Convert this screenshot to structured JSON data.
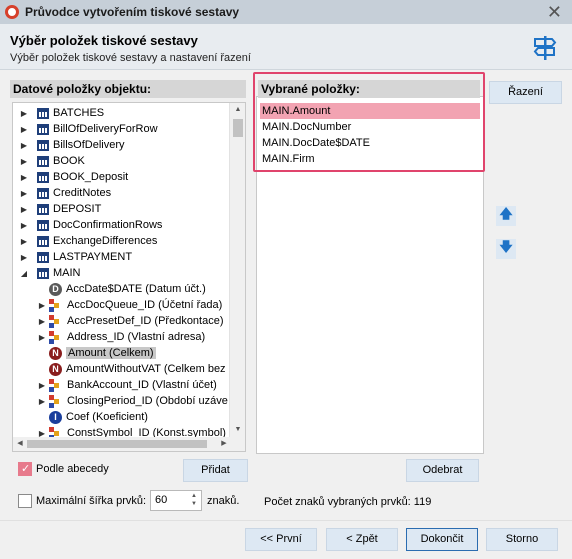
{
  "window": {
    "title": "Průvodce vytvořením tiskové sestavy",
    "close_symbol": "✕"
  },
  "header": {
    "title": "Výběr položek tiskové sestavy",
    "subtitle": "Výběr položek tiskové sestavy a nastavení řazení",
    "icon": "signpost-icon"
  },
  "left_panel": {
    "label": "Datové položky objektu:",
    "tree": [
      {
        "label": "BATCHES",
        "type": "table",
        "expand": "▶"
      },
      {
        "label": "BillOfDeliveryForRow",
        "type": "table",
        "expand": "▶"
      },
      {
        "label": "BillsOfDelivery",
        "type": "table",
        "expand": "▶"
      },
      {
        "label": "BOOK",
        "type": "table",
        "expand": "▶"
      },
      {
        "label": "BOOK_Deposit",
        "type": "table",
        "expand": "▶"
      },
      {
        "label": "CreditNotes",
        "type": "table",
        "expand": "▶"
      },
      {
        "label": "DEPOSIT",
        "type": "table",
        "expand": "▶"
      },
      {
        "label": "DocConfirmationRows",
        "type": "table",
        "expand": "▶"
      },
      {
        "label": "ExchangeDifferences",
        "type": "table",
        "expand": "▶"
      },
      {
        "label": "LASTPAYMENT",
        "type": "table",
        "expand": "▶"
      },
      {
        "label": "MAIN",
        "type": "table",
        "expand": "◢"
      },
      {
        "label": "AccDate$DATE (Datum účt.)",
        "type": "date",
        "glyph": "D"
      },
      {
        "label": "AccDocQueue_ID (Účetní řada)",
        "type": "relation",
        "expand": "▶"
      },
      {
        "label": "AccPresetDef_ID (Předkontace)",
        "type": "relation",
        "expand": "▶"
      },
      {
        "label": "Address_ID (Vlastní adresa)",
        "type": "relation",
        "expand": "▶"
      },
      {
        "label": "Amount (Celkem)",
        "type": "number",
        "glyph": "N",
        "selected": true
      },
      {
        "label": "AmountWithoutVAT (Celkem bez",
        "type": "number",
        "glyph": "N"
      },
      {
        "label": "BankAccount_ID (Vlastní účet)",
        "type": "relation",
        "expand": "▶"
      },
      {
        "label": "ClosingPeriod_ID (Období uzáve",
        "type": "relation",
        "expand": "▶"
      },
      {
        "label": "Coef (Koeficient)",
        "type": "integer",
        "glyph": "I"
      },
      {
        "label": "ConstSymbol_ID (Konst.symbol)",
        "type": "relation",
        "expand": "▶"
      }
    ],
    "scroll_up": "▲",
    "scroll_down": "▼",
    "scroll_left": "◀",
    "scroll_right": "▶"
  },
  "right_panel": {
    "label": "Vybrané položky:",
    "items": [
      "MAIN.Amount",
      "MAIN.DocNumber",
      "MAIN.DocDate$DATE",
      "MAIN.Firm"
    ],
    "active_index": 0
  },
  "buttons": {
    "sort": "Řazení",
    "move_up": "🡅",
    "move_down": "🡇",
    "add": "Přidat",
    "remove": "Odebrat",
    "first": "<< První",
    "back": "< Zpět",
    "finish": "Dokončit",
    "cancel": "Storno"
  },
  "options": {
    "alphabetical_label": "Podle abecedy",
    "alphabetical_checked": true,
    "max_width_label": "Maximální šířka prvků:",
    "max_width_checked": false,
    "max_width_value": "60",
    "max_width_unit": "znaků.",
    "spin_up": "▲",
    "spin_down": "▼",
    "char_count_text": "Počet znaků vybraných prvků: 119"
  },
  "colors": {
    "selection_highlight": "#f2a3b2",
    "frame": "#e0446c",
    "accent_arrow": "#1f73c6"
  }
}
